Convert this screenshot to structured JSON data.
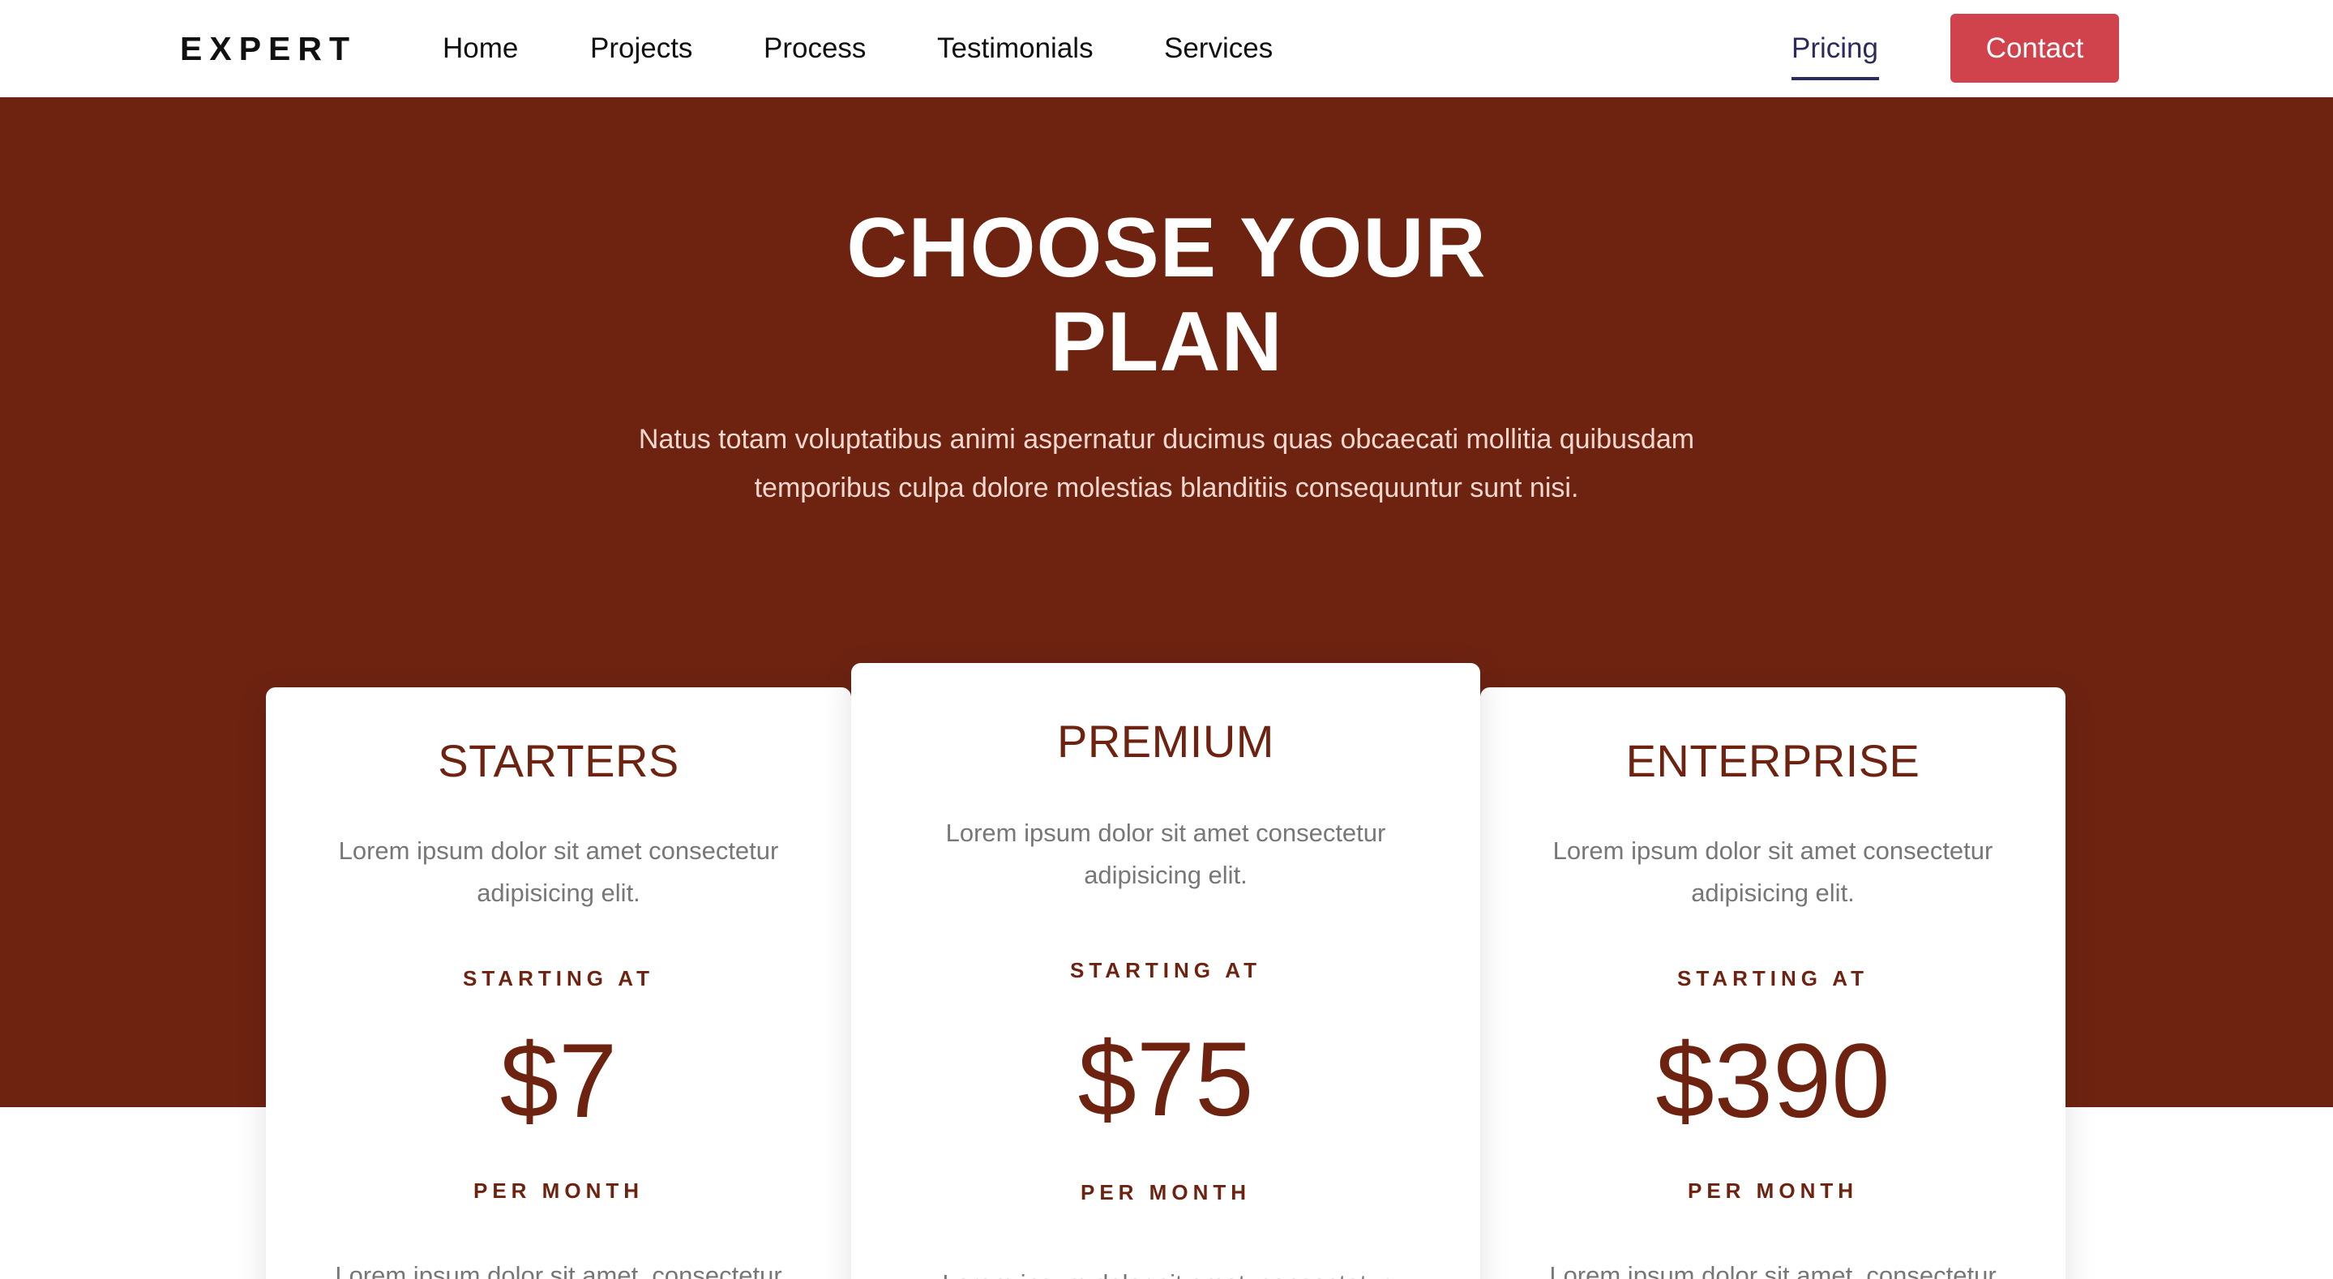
{
  "header": {
    "logo": "EXPERT",
    "nav": {
      "home": "Home",
      "projects": "Projects",
      "process": "Process",
      "testimonials": "Testimonials",
      "services": "Services",
      "pricing": "Pricing"
    },
    "contact_label": "Contact",
    "active_item": "Pricing"
  },
  "hero": {
    "title": "CHOOSE YOUR PLAN",
    "subtitle": "Natus totam voluptatibus animi aspernatur ducimus quas obcaecati mollitia quibusdam temporibus culpa dolore molestias blanditiis consequuntur sunt nisi."
  },
  "plans": [
    {
      "name": "STARTERS",
      "description": "Lorem ipsum dolor sit amet consectetur adipisicing elit.",
      "starting_label": "STARTING AT",
      "price": "$7",
      "period": "PER MONTH",
      "feature_partial": "Lorem ipsum dolor sit amet, consectetur"
    },
    {
      "name": "PREMIUM",
      "description": "Lorem ipsum dolor sit amet consectetur adipisicing elit.",
      "starting_label": "STARTING AT",
      "price": "$75",
      "period": "PER MONTH",
      "feature_partial": "Lorem ipsum dolor sit amet, consectetur"
    },
    {
      "name": "ENTERPRISE",
      "description": "Lorem ipsum dolor sit amet consectetur adipisicing elit.",
      "starting_label": "STARTING AT",
      "price": "$390",
      "period": "PER MONTH",
      "feature_partial": "Lorem ipsum dolor sit amet, consectetur"
    }
  ],
  "colors": {
    "hero_background": "#6e2311",
    "accent_text": "#6e2311",
    "contact_button": "#d1434c",
    "active_nav": "#2a2a5e"
  }
}
